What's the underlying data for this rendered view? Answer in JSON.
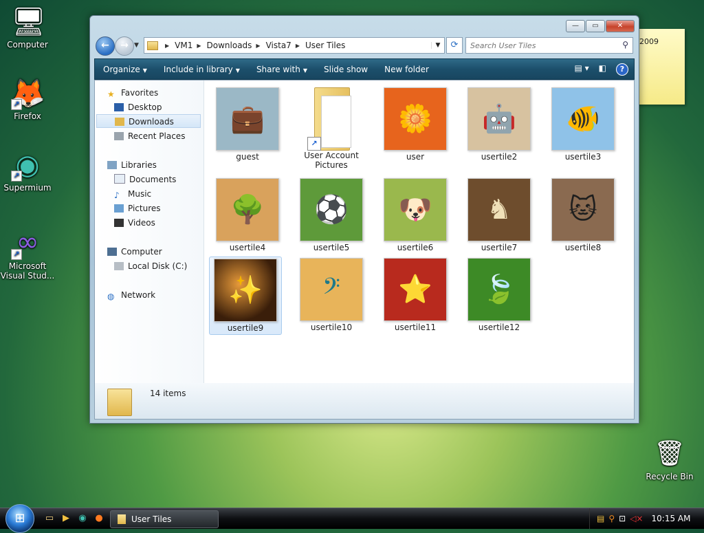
{
  "desktop": {
    "icons": [
      {
        "label": "Computer",
        "glyph": "🖥",
        "icon": "computer-icon"
      },
      {
        "label": "Firefox",
        "glyph": "🦊",
        "icon": "firefox-icon"
      },
      {
        "label": "Supermium",
        "glyph": "◉",
        "icon": "supermium-icon"
      },
      {
        "label": "Microsoft Visual Stud...",
        "glyph": "∞",
        "icon": "visual-studio-icon"
      },
      {
        "label": "Recycle Bin",
        "glyph": "🗑",
        "icon": "recycle-bin-icon"
      }
    ],
    "sticky_text": "2009"
  },
  "window": {
    "caption": {
      "minimize": "—",
      "maximize": "▭",
      "close": "✕"
    },
    "nav": {
      "back": "←",
      "forward": "→"
    },
    "address": [
      "VM1",
      "Downloads",
      "Vista7",
      "User Tiles"
    ],
    "search_placeholder": "Search User Tiles",
    "toolbar": {
      "organize": "Organize",
      "include": "Include in library",
      "share": "Share with",
      "slideshow": "Slide show",
      "new_folder": "New folder"
    },
    "nav_pane": {
      "favorites": "Favorites",
      "desktop": "Desktop",
      "downloads": "Downloads",
      "recent": "Recent Places",
      "libraries": "Libraries",
      "documents": "Documents",
      "music": "Music",
      "pictures": "Pictures",
      "videos": "Videos",
      "computer": "Computer",
      "local_disk": "Local Disk (C:)",
      "network": "Network"
    },
    "files": [
      {
        "name": "guest",
        "glyph": "💼",
        "bg": "#9bb8c6"
      },
      {
        "name": "User Account Pictures",
        "folder": true
      },
      {
        "name": "user",
        "glyph": "🌼",
        "bg": "#e7641d"
      },
      {
        "name": "usertile2",
        "glyph": "🤖",
        "bg": "#d7c2a0"
      },
      {
        "name": "usertile3",
        "glyph": "🐠",
        "bg": "#8fc2e8"
      },
      {
        "name": "usertile4",
        "glyph": "🌳",
        "bg": "#d9a25c"
      },
      {
        "name": "usertile5",
        "glyph": "⚽",
        "bg": "#5e9a3a"
      },
      {
        "name": "usertile6",
        "glyph": "🐶",
        "bg": "#9ab84d"
      },
      {
        "name": "usertile7",
        "glyph": "♞",
        "bg": "#6e4d2d"
      },
      {
        "name": "usertile8",
        "glyph": "🐱",
        "bg": "#8a6a50"
      },
      {
        "name": "usertile9",
        "glyph": "✨",
        "bg": "#3a1e0a"
      },
      {
        "name": "usertile10",
        "glyph": "𝄢",
        "bg": "#e8b45a"
      },
      {
        "name": "usertile11",
        "glyph": "⭐",
        "bg": "#b82a1e"
      },
      {
        "name": "usertile12",
        "glyph": "🍃",
        "bg": "#3d8a26"
      }
    ],
    "details": {
      "count": "14 items"
    }
  },
  "taskbar": {
    "start": "⊞",
    "task": "User Tiles",
    "clock": "10:15 AM"
  }
}
